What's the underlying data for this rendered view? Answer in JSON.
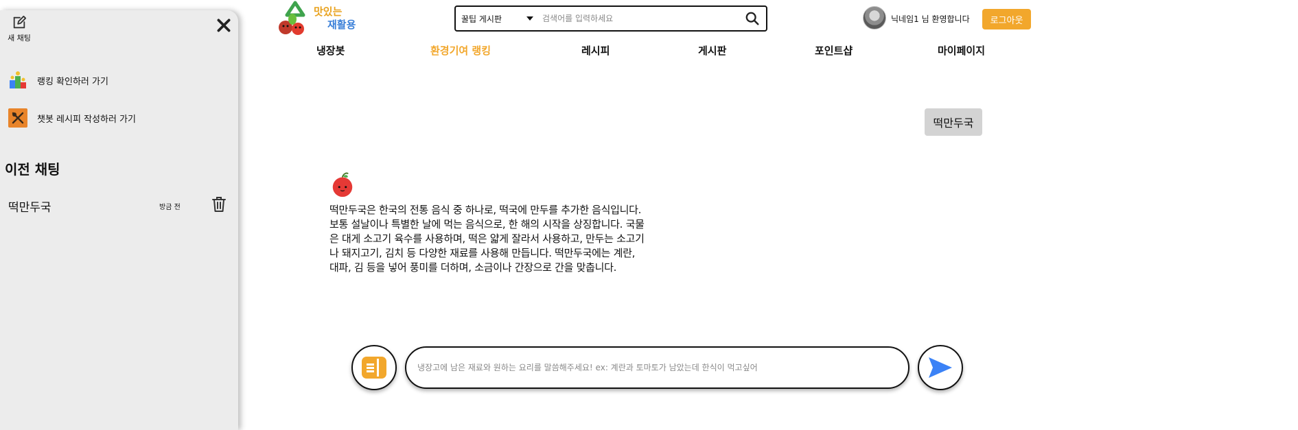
{
  "sidebar": {
    "new_chat_label": "새 채팅",
    "links": {
      "ranking": "랭킹 확인하러 가기",
      "recipe": "챗봇 레시피 작성하러 가기"
    },
    "previous_heading": "이전 채팅",
    "history": [
      {
        "title": "떡만두국",
        "time": "방금 전"
      }
    ]
  },
  "header": {
    "logo": {
      "line1": "맛있는",
      "line2": "재활용"
    },
    "search": {
      "category": "꿀팁 게시판",
      "placeholder": "검색어를 입력하세요"
    },
    "welcome": "닉네임1 님 환영합니다",
    "logout_label": "로그아웃"
  },
  "nav": {
    "items": [
      "냉장봇",
      "환경기여 랭킹",
      "레시피",
      "게시판",
      "포인트샵",
      "마이페이지"
    ],
    "active": "환경기여 랭킹"
  },
  "chat": {
    "user_message": "떡만두국",
    "bot_message": "떡만두국은 한국의 전통 음식 중 하나로, 떡국에 만두를 추가한 음식입니다. 보통 설날이나 특별한 날에 먹는 음식으로, 한 해의 시작을 상징합니다. 국물은 대게 소고기 육수를 사용하며, 떡은 얇게 잘라서 사용하고, 만두는 소고기나 돼지고기, 김치 등 다양한 재료를 사용해 만듭니다. 떡만두국에는 계란, 대파, 김 등을 넣어 풍미를 더하며, 소금이나 간장으로 간을 맞춥니다.",
    "input_placeholder": "냉장고에 남은 재료와 원하는 요리를 말씀해주세요! ex: 계란과 토마토가 남았는데 한식이 먹고싶어"
  },
  "colors": {
    "accent": "#f2a72c",
    "send": "#3b82f6",
    "sidebar_bg": "#ececec"
  }
}
